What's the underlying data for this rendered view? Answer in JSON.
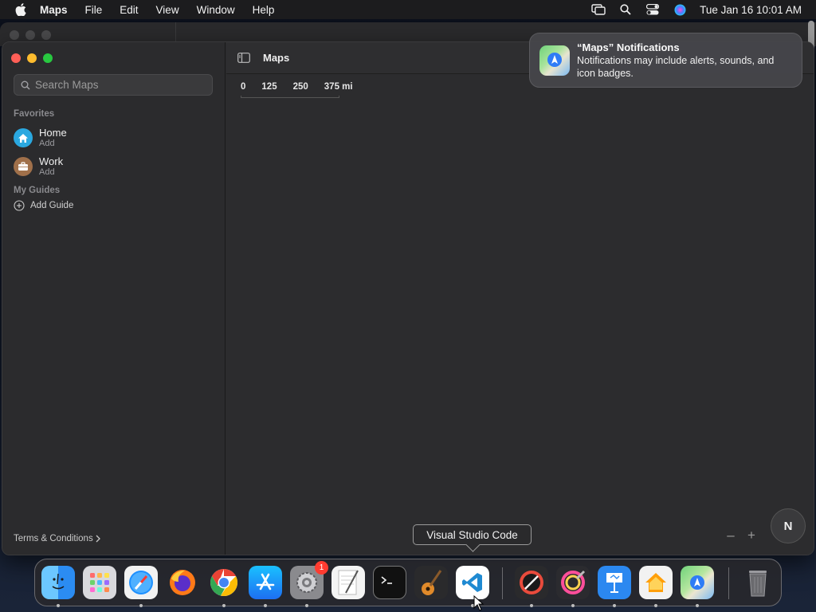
{
  "menubar": {
    "app": "Maps",
    "items": [
      "File",
      "Edit",
      "View",
      "Window",
      "Help"
    ],
    "clock": "Tue Jan 16  10:01 AM"
  },
  "window": {
    "title": "Maps"
  },
  "sidebar": {
    "search_placeholder": "Search Maps",
    "favorites_title": "Favorites",
    "favorites": [
      {
        "name": "Home",
        "sub": "Add",
        "icon": "house-icon",
        "color": "#2aa8e0"
      },
      {
        "name": "Work",
        "sub": "Add",
        "icon": "briefcase-icon",
        "color": "#a0704a"
      }
    ],
    "guides_title": "My Guides",
    "add_guide": "Add Guide",
    "terms": "Terms & Conditions"
  },
  "map": {
    "scale_labels": [
      "0",
      "125",
      "250",
      "375 mi"
    ],
    "compass_label": "N",
    "zoom_out": "–",
    "zoom_in": "+"
  },
  "notification": {
    "title": "“Maps” Notifications",
    "text": "Notifications may include alerts, sounds, and icon badges."
  },
  "tooltip": "Visual Studio Code",
  "dock": {
    "apps": [
      {
        "name": "Finder",
        "icon": "finder-icon"
      },
      {
        "name": "Launchpad",
        "icon": "launchpad-icon"
      },
      {
        "name": "Safari",
        "icon": "safari-icon"
      },
      {
        "name": "Firefox",
        "icon": "firefox-icon"
      },
      {
        "name": "Chrome",
        "icon": "chrome-icon"
      },
      {
        "name": "App Store",
        "icon": "app-store-icon"
      },
      {
        "name": "System Settings",
        "icon": "settings-icon",
        "badge": "1"
      },
      {
        "name": "TextEdit",
        "icon": "textedit-icon"
      },
      {
        "name": "Terminal",
        "icon": "terminal-icon"
      },
      {
        "name": "GarageBand",
        "icon": "guitar-icon"
      },
      {
        "name": "Visual Studio Code",
        "icon": "vscode-icon"
      },
      {
        "name": "Instruments",
        "icon": "compass-app-icon"
      },
      {
        "name": "ColorSync",
        "icon": "colorsync-icon"
      },
      {
        "name": "Keynote",
        "icon": "keynote-icon"
      },
      {
        "name": "Home",
        "icon": "home-app-icon"
      },
      {
        "name": "Maps",
        "icon": "maps-icon"
      },
      {
        "name": "Trash",
        "icon": "trash-icon"
      }
    ]
  }
}
